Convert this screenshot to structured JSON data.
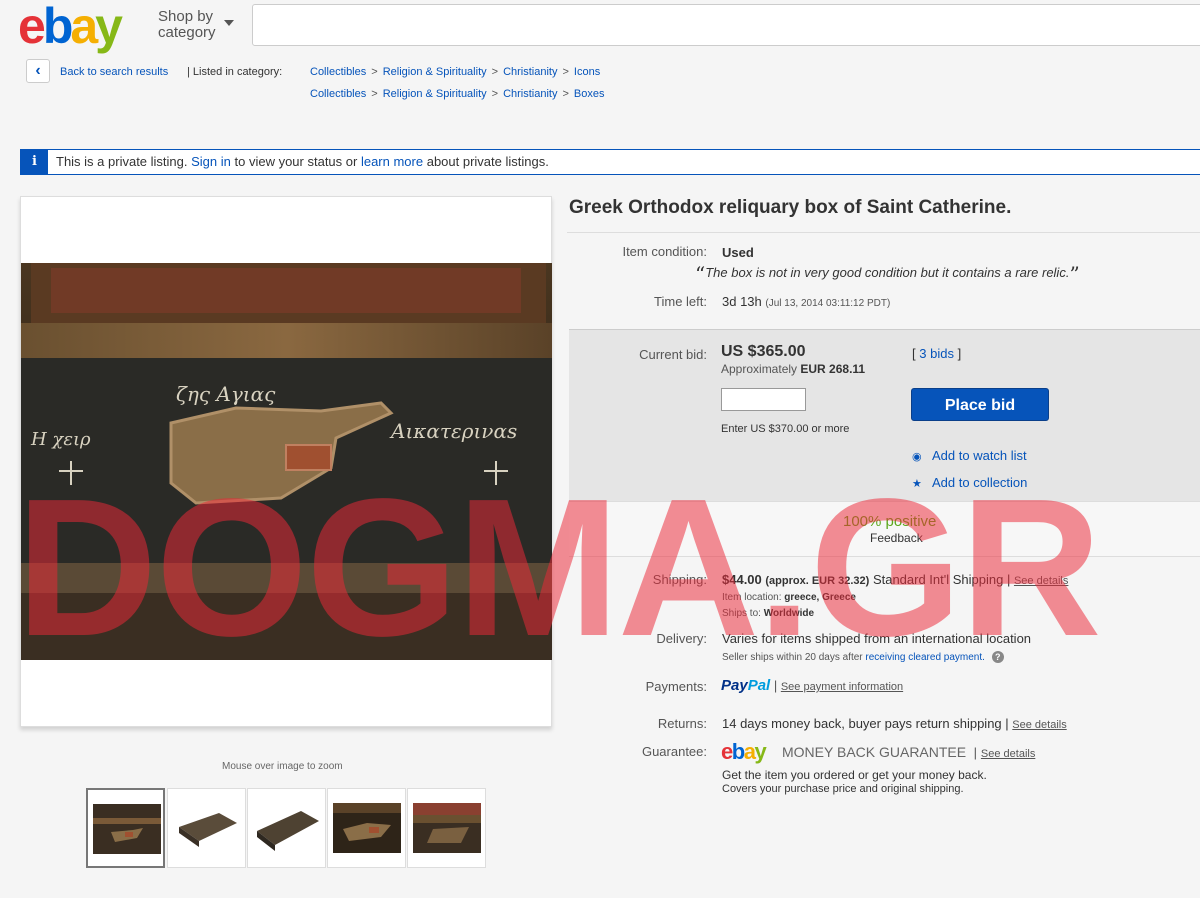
{
  "header": {
    "logo": [
      "e",
      "b",
      "a",
      "y"
    ],
    "shop_by_line1": "Shop by",
    "shop_by_line2": "category",
    "search_placeholder": ""
  },
  "breadcrumb": {
    "back_label": "Back to search results",
    "listed_in": "| Listed in category:",
    "paths": [
      [
        "Collectibles",
        "Religion & Spirituality",
        "Christianity",
        "Icons"
      ],
      [
        "Collectibles",
        "Religion & Spirituality",
        "Christianity",
        "Boxes"
      ]
    ],
    "separator": ">"
  },
  "notice": {
    "icon": "i",
    "text_before": "This is a private listing.",
    "sign_in": "Sign in",
    "text_mid": "to view your status or",
    "learn_more": "learn more",
    "text_after": "about private listings."
  },
  "gallery": {
    "zoom_hint": "Mouse over image to zoom",
    "image_text": {
      "top": "ζης Αγιας",
      "left": "Η χειρ",
      "right": "Αικατεριναs"
    },
    "thumbnails": 5,
    "selected_thumbnail": 1
  },
  "item": {
    "title": "Greek Orthodox reliquary box of Saint Catherine.",
    "condition_label": "Item condition:",
    "condition_value": "Used",
    "condition_quote": "The box is not in very good condition but it contains a rare relic.",
    "time_left_label": "Time left:",
    "time_left_value": "3d 13h",
    "time_left_detail": "(Jul 13, 2014   03:11:12 PDT)"
  },
  "bid": {
    "label": "Current bid:",
    "value": "US $365.00",
    "approx_prefix": "Approximately",
    "approx_value": "EUR 268.11",
    "bids_open": "[",
    "bids_link": "3 bids",
    "bids_close": "]",
    "input_value": "",
    "hint": "Enter US $370.00 or more",
    "place_bid": "Place bid",
    "watch": "Add to watch list",
    "collection": "Add to collection",
    "feedback_pct": "100% positive",
    "feedback_label": "Feedback"
  },
  "shipping": {
    "label": "Shipping:",
    "cost": "$44.00",
    "approx": "(approx. EUR 32.32)",
    "service": "Standard Int'l Shipping",
    "see_details": "See details",
    "location_label": "Item location:",
    "location_value": "greece, Greece",
    "ships_to_label": "Ships to:",
    "ships_to_value": "Worldwide"
  },
  "delivery": {
    "label": "Delivery:",
    "value": "Varies for items shipped from an international location",
    "note_before": "Seller ships within 20 days after",
    "note_link": "receiving cleared payment.",
    "help_icon": "?"
  },
  "payments": {
    "label": "Payments:",
    "paypal_1": "Pay",
    "paypal_2": "Pal",
    "see_info": "See payment information"
  },
  "returns": {
    "label": "Returns:",
    "value": "14 days money back, buyer pays return shipping",
    "see_details": "See details"
  },
  "guarantee": {
    "label": "Guarantee:",
    "logo": [
      "e",
      "b",
      "a",
      "y"
    ],
    "text": "MONEY BACK GUARANTEE",
    "see_details": "See details",
    "line1": "Get the item you ordered or get your money back.",
    "line2": "Covers your purchase price and original shipping."
  },
  "watermark": "DOGMA.GR"
}
